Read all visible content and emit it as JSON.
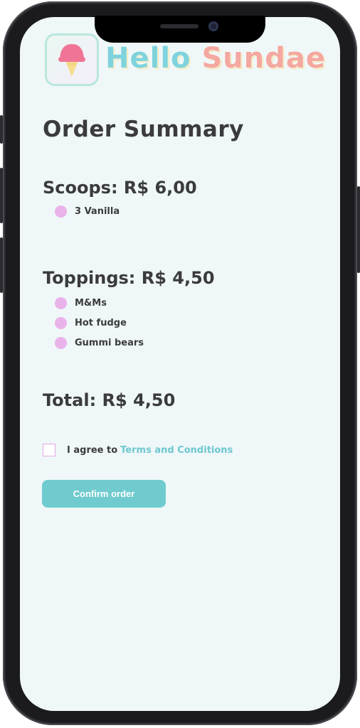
{
  "brand": {
    "word1": "Hello",
    "word2": "Sundae"
  },
  "page_title": "Order Summary",
  "scoops": {
    "title": "Scoops: R$ 6,00",
    "items": [
      "3 Vanilla"
    ]
  },
  "toppings": {
    "title": "Toppings: R$ 4,50",
    "items": [
      "M&Ms",
      "Hot fudge",
      "Gummi bears"
    ]
  },
  "total": "Total: R$ 4,50",
  "terms": {
    "prefix": "I agree to",
    "link": "Terms and Conditions",
    "checked": false
  },
  "confirm_button": "Confirm order",
  "colors": {
    "accent": "#70cbcf",
    "bullet": "#e9b3ea",
    "text": "#3b3b3f",
    "background": "#eff7f8"
  }
}
